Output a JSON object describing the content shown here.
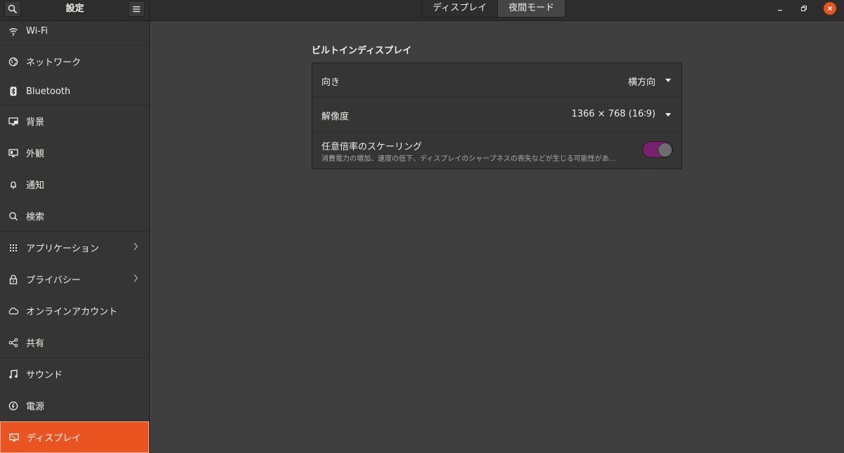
{
  "header": {
    "title": "設定",
    "search_icon": "search-icon",
    "menu_icon": "hamburger-menu-icon",
    "tabs": [
      {
        "label": "ディスプレイ",
        "active": false
      },
      {
        "label": "夜間モード",
        "active": true
      }
    ],
    "window_controls": [
      "minimize-icon",
      "restore-icon",
      "close-icon"
    ]
  },
  "sidebar": {
    "items": [
      {
        "label": "Wi-Fi",
        "icon": "wifi-icon"
      },
      {
        "label": "ネットワーク",
        "icon": "network-globe-icon"
      },
      {
        "label": "Bluetooth",
        "icon": "bluetooth-icon"
      },
      {
        "label": "背景",
        "icon": "background-icon"
      },
      {
        "label": "外観",
        "icon": "appearance-icon"
      },
      {
        "label": "通知",
        "icon": "bell-icon"
      },
      {
        "label": "検索",
        "icon": "search-icon"
      },
      {
        "label": "アプリケーション",
        "icon": "apps-grid-icon",
        "has_chevron": true
      },
      {
        "label": "プライバシー",
        "icon": "lock-icon",
        "has_chevron": true
      },
      {
        "label": "オンラインアカウント",
        "icon": "cloud-icon"
      },
      {
        "label": "共有",
        "icon": "share-icon"
      },
      {
        "label": "サウンド",
        "icon": "music-note-icon"
      },
      {
        "label": "電源",
        "icon": "power-icon"
      },
      {
        "label": "ディスプレイ",
        "icon": "display-icon",
        "selected": true
      }
    ]
  },
  "main": {
    "section_title": "ビルトインディスプレイ",
    "orientation": {
      "label": "向き",
      "value": "横方向"
    },
    "resolution": {
      "label": "解像度",
      "value": "1366 × 768 (16∶9)"
    },
    "fractional_scaling": {
      "label": "任意倍率のスケーリング",
      "description": "消費電力の増加、速度の低下、ディスプレイのシャープネスの喪失などが生じる可能性があ…",
      "enabled": true
    }
  },
  "colors": {
    "accent": "#e95420",
    "toggle_on": "#77216f",
    "background": "#3f3f3f",
    "sidebar": "#353535",
    "headerbar": "#2d2d2d"
  }
}
